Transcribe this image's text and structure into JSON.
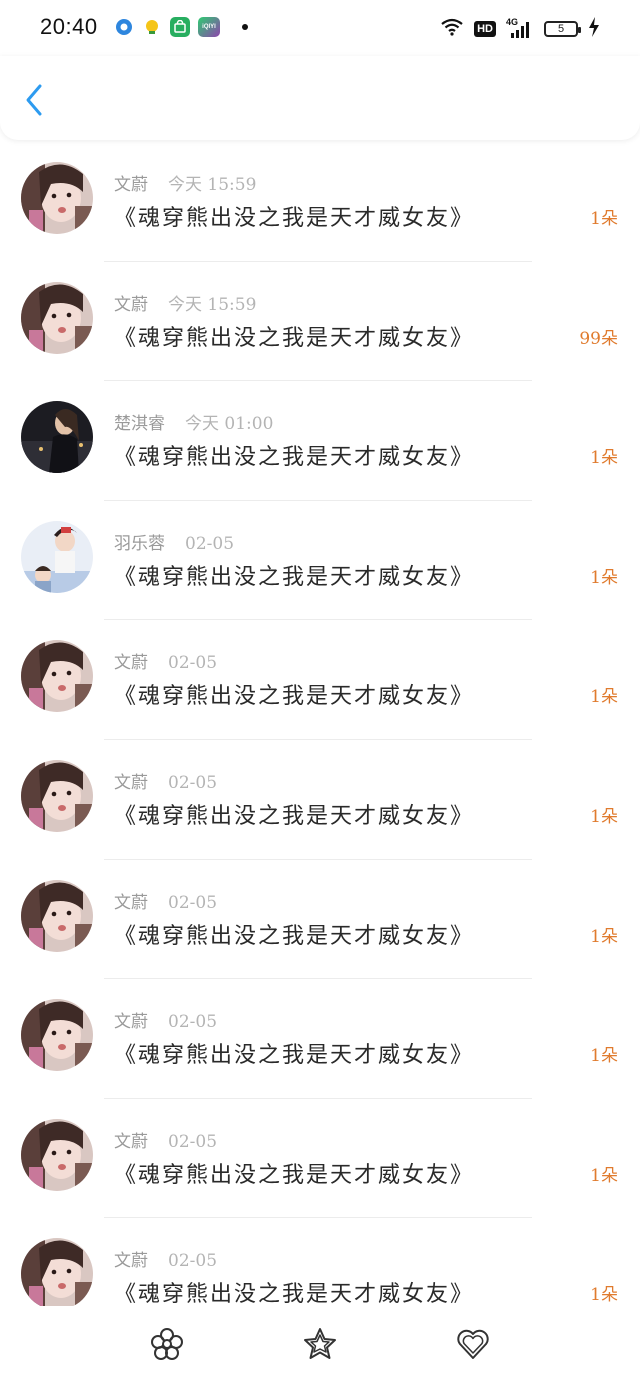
{
  "status_bar": {
    "time": "20:40",
    "hd_label": "HD",
    "network_label": "4G",
    "battery_level": "5",
    "icons": [
      "location-app-icon",
      "lightbulb-app-icon",
      "shopping-app-icon",
      "iqiyi-app-icon",
      "notification-dot-icon",
      "wifi-icon",
      "hd-icon",
      "signal-icon",
      "battery-icon",
      "charging-icon"
    ],
    "iqiyi_label": "iQIYI"
  },
  "header": {
    "back_icon": "chevron-left-icon",
    "accent_color": "#2d9bf0"
  },
  "list": {
    "items": [
      {
        "user": "文蔚",
        "date": "今天 15:59",
        "title": "《魂穿熊出没之我是天才威女友》",
        "count": "1朵",
        "avatar": "avatar-a"
      },
      {
        "user": "文蔚",
        "date": "今天 15:59",
        "title": "《魂穿熊出没之我是天才威女友》",
        "count": "99朵",
        "avatar": "avatar-a"
      },
      {
        "user": "楚淇睿",
        "date": "今天 01:00",
        "title": "《魂穿熊出没之我是天才威女友》",
        "count": "1朵",
        "avatar": "avatar-b"
      },
      {
        "user": "羽乐蓉",
        "date": "02-05",
        "title": "《魂穿熊出没之我是天才威女友》",
        "count": "1朵",
        "avatar": "avatar-c"
      },
      {
        "user": "文蔚",
        "date": "02-05",
        "title": "《魂穿熊出没之我是天才威女友》",
        "count": "1朵",
        "avatar": "avatar-a"
      },
      {
        "user": "文蔚",
        "date": "02-05",
        "title": "《魂穿熊出没之我是天才威女友》",
        "count": "1朵",
        "avatar": "avatar-a"
      },
      {
        "user": "文蔚",
        "date": "02-05",
        "title": "《魂穿熊出没之我是天才威女友》",
        "count": "1朵",
        "avatar": "avatar-a"
      },
      {
        "user": "文蔚",
        "date": "02-05",
        "title": "《魂穿熊出没之我是天才威女友》",
        "count": "1朵",
        "avatar": "avatar-a"
      },
      {
        "user": "文蔚",
        "date": "02-05",
        "title": "《魂穿熊出没之我是天才威女友》",
        "count": "1朵",
        "avatar": "avatar-a"
      },
      {
        "user": "文蔚",
        "date": "02-05",
        "title": "《魂穿熊出没之我是天才威女友》",
        "count": "1朵",
        "avatar": "avatar-a"
      }
    ],
    "count_color": "#e07b2e"
  },
  "bottom_bar": {
    "icons": [
      "flower-icon",
      "star-icon",
      "heart-icon"
    ]
  }
}
